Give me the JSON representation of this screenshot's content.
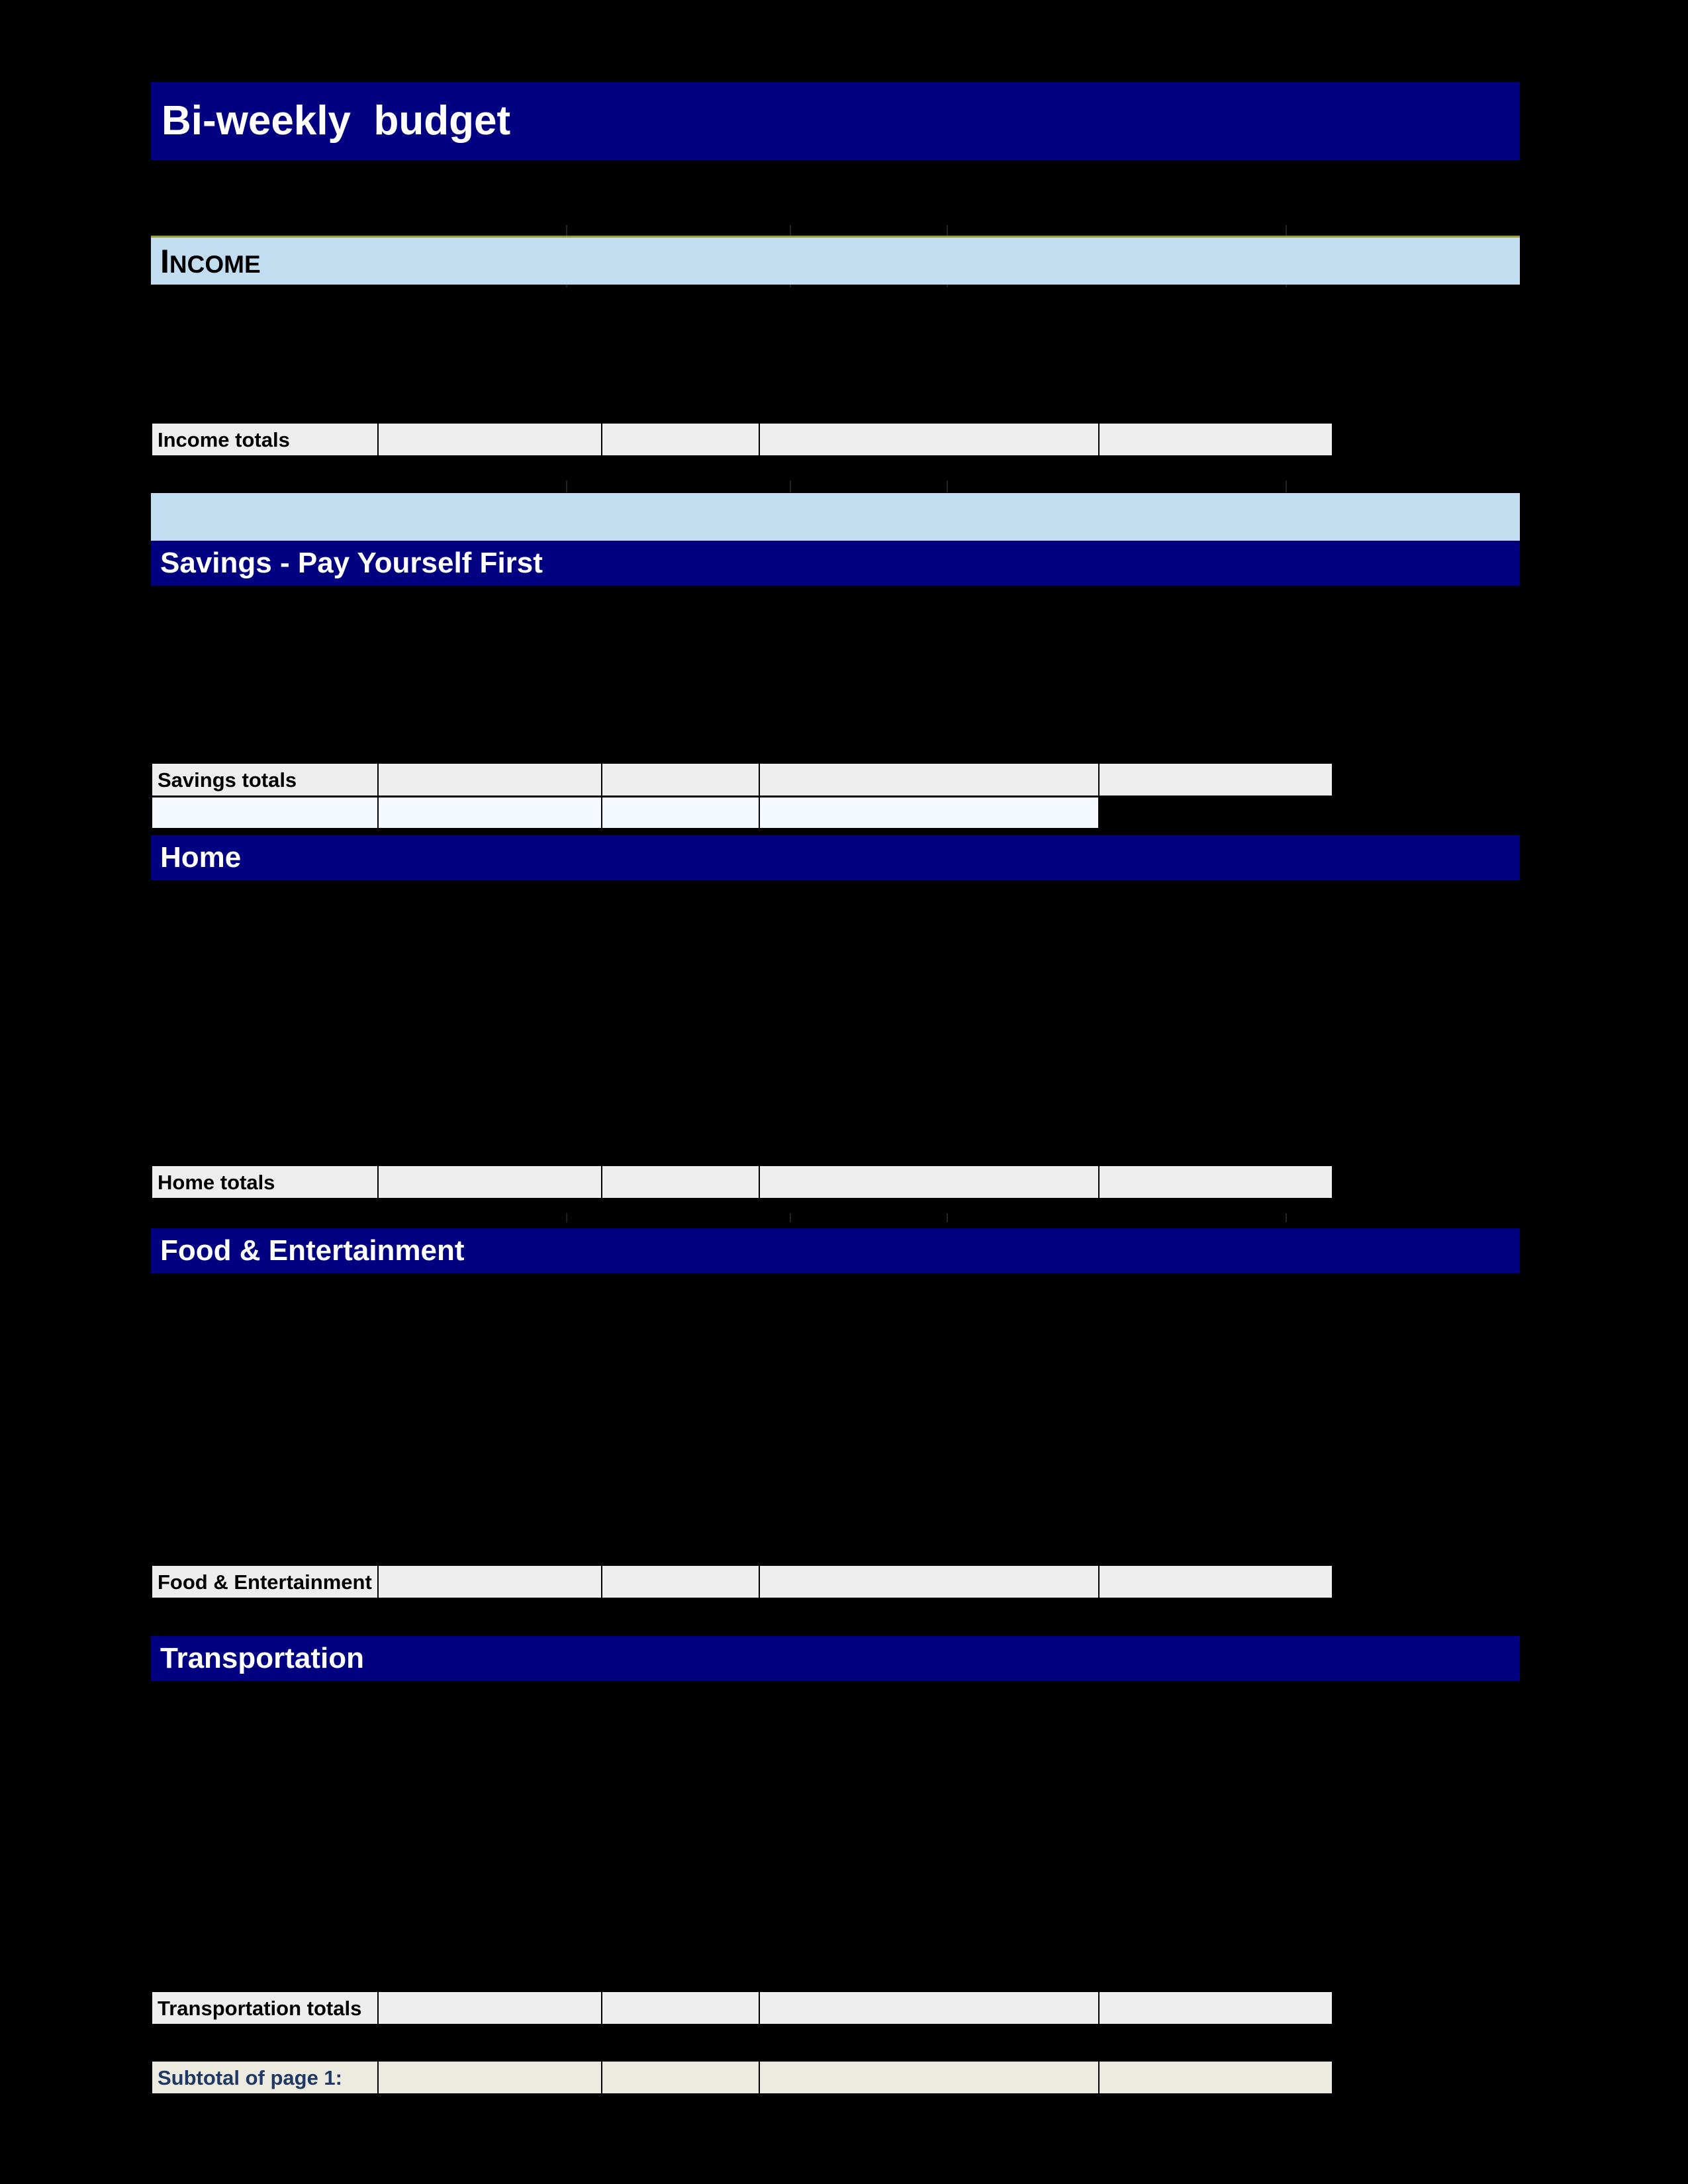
{
  "document": {
    "title": "Bi-weekly  budget"
  },
  "colors": {
    "page_background": "#000000",
    "header_navy": "#000080",
    "section_light_blue": "#c3ddf0",
    "totals_grey": "#eeeeee",
    "subtotal_cream": "#edebdf",
    "blank_row_white": "#f4faff",
    "subtotal_text_navy": "#1f3864",
    "income_band_top_border": "#9b9b2e",
    "header_text": "#ffffff",
    "body_text": "#000000"
  },
  "sections": {
    "income": {
      "header_cap": "I",
      "header_rest": "NCOME",
      "header_full": "INCOME",
      "totals_label": "Income totals",
      "totals_values": [
        "",
        "",
        "",
        ""
      ]
    },
    "savings": {
      "header": "Savings - Pay Yourself First",
      "totals_label": "Savings totals",
      "totals_values": [
        "",
        "",
        "",
        ""
      ],
      "blank_row_values": [
        "",
        "",
        "",
        ""
      ]
    },
    "home": {
      "header": "Home",
      "totals_label": "Home totals",
      "totals_values": [
        "",
        "",
        "",
        ""
      ]
    },
    "food_entertainment": {
      "header": "Food & Entertainment",
      "totals_label": "Food & Entertainment total",
      "totals_values": [
        "",
        "",
        "",
        ""
      ]
    },
    "transportation": {
      "header": "Transportation",
      "totals_label": "Transportation totals",
      "totals_values": [
        "",
        "",
        "",
        ""
      ]
    }
  },
  "footer": {
    "subtotal_label": "Subtotal of page 1:",
    "subtotal_values": [
      "",
      "",
      "",
      ""
    ]
  }
}
